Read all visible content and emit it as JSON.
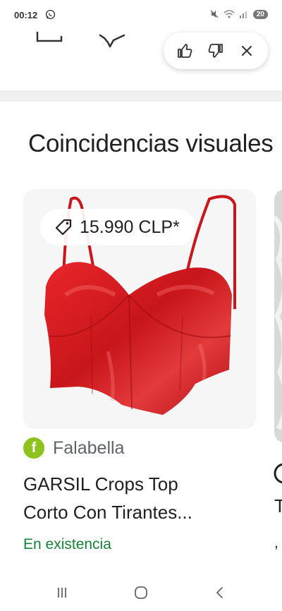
{
  "status_bar": {
    "time": "00:12",
    "battery": "20"
  },
  "feedback": {
    "like_label": "thumbs up",
    "dislike_label": "thumbs down",
    "close_label": "close"
  },
  "section": {
    "title": "Coincidencias visuales"
  },
  "product": {
    "price": "15.990 CLP*",
    "merchant": "Falabella",
    "merchant_initial": "f",
    "title_line1": "GARSIL Crops Top",
    "title_line2": "Corto Con Tirantes...",
    "availability": "En existencia"
  },
  "next_product_peek": {
    "line1": "T",
    "line2": "T",
    "line3": ","
  },
  "colors": {
    "accent_green": "#188038",
    "product_red": "#d51a1e",
    "merchant_logo": "#8ec31f"
  },
  "icons": [
    "whatsapp-icon",
    "mute-icon",
    "wifi-icon",
    "signal-icon",
    "thumbs-up-icon",
    "thumbs-down-icon",
    "close-icon",
    "price-tag-icon",
    "recents-icon",
    "home-icon",
    "back-icon"
  ]
}
